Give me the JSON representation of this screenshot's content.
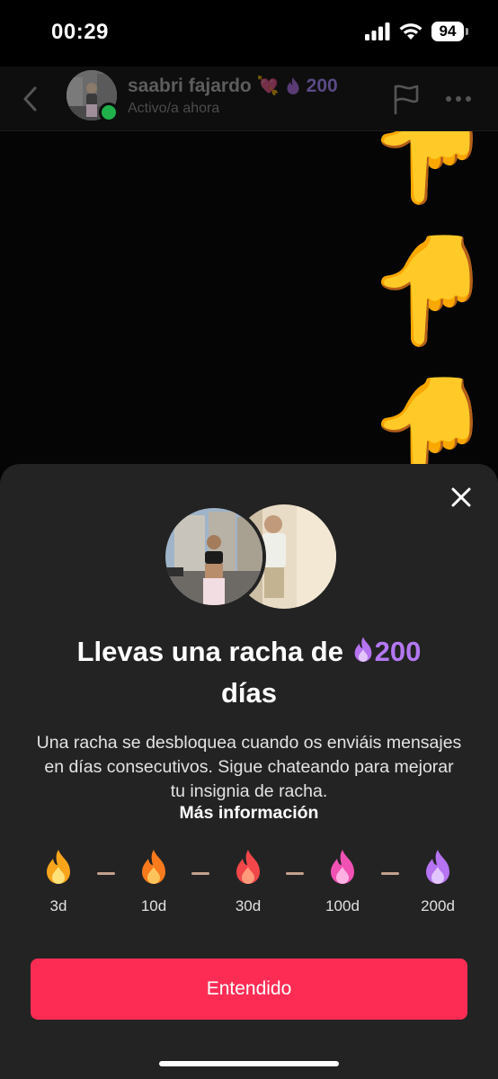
{
  "status_bar": {
    "time": "00:29",
    "battery": "94",
    "icons": [
      "cellular-signal-icon",
      "wifi-icon",
      "battery-icon"
    ]
  },
  "chat_header": {
    "user_name": "saabri fajardo",
    "name_emoji": "💘",
    "streak_count": "200",
    "presence": "Activo/a ahora",
    "icons": [
      "back-arrow-icon",
      "flag-icon",
      "more-options-icon"
    ]
  },
  "chat_body": {
    "messages": [
      "👇",
      "👇",
      "👇"
    ]
  },
  "streak_sheet": {
    "title_prefix": "Llevas una racha de",
    "title_count": "200",
    "title_suffix": "días",
    "description": "Una racha se desbloquea cuando os enviáis mensajes en días consecutivos. Sigue chateando para mejorar tu insignia de racha.",
    "more_info_link": "Más información",
    "milestones": [
      {
        "label": "3d",
        "color": "#f8a51c"
      },
      {
        "label": "10d",
        "color": "#f77a1d"
      },
      {
        "label": "30d",
        "color": "#f2474a"
      },
      {
        "label": "100d",
        "color": "#f052b4"
      },
      {
        "label": "200d",
        "color": "#b673f2"
      }
    ],
    "confirm_button": "Entendido"
  },
  "colors": {
    "accent": "#fd2c55",
    "streak_purple": "#b478f2",
    "sheet_bg": "#232323",
    "online": "#20b14a"
  }
}
